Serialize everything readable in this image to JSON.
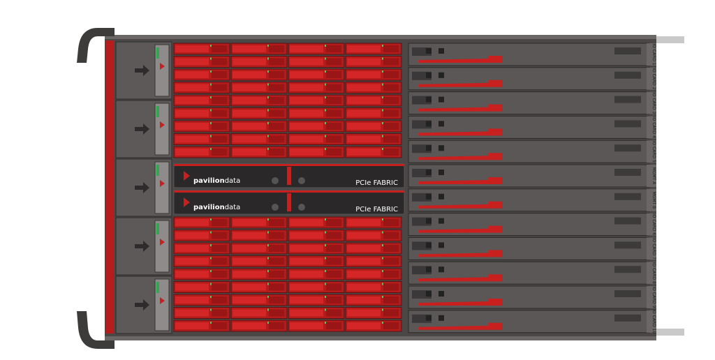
{
  "fabric_modules": [
    {
      "brand_bold": "pavilion",
      "brand_light": "data",
      "label": "PCIe FABRIC"
    },
    {
      "brand_bold": "pavilion",
      "brand_light": "data",
      "label": "PCIe FABRIC"
    }
  ],
  "io_cards": [
    "IO CARD 1",
    "IO CARD 2",
    "IO CARD 3",
    "IO CARD 4",
    "IO CARD 5",
    "MGMT A",
    "MGMT B",
    "IO CARD 6",
    "IO CARD 7",
    "IO CARD 8",
    "IO CARD 9",
    "IO CARD 10"
  ],
  "colors": {
    "accent_red": "#c81f1f",
    "chassis_dark": "#3a3838",
    "chassis_grey": "#6d6a69",
    "drive_red": "#b41c1c"
  },
  "icons": {
    "psu_arrow": "arrow-right-icon",
    "handle": "rack-handle-icon",
    "brand_logo": "pavilion-logo-icon"
  }
}
